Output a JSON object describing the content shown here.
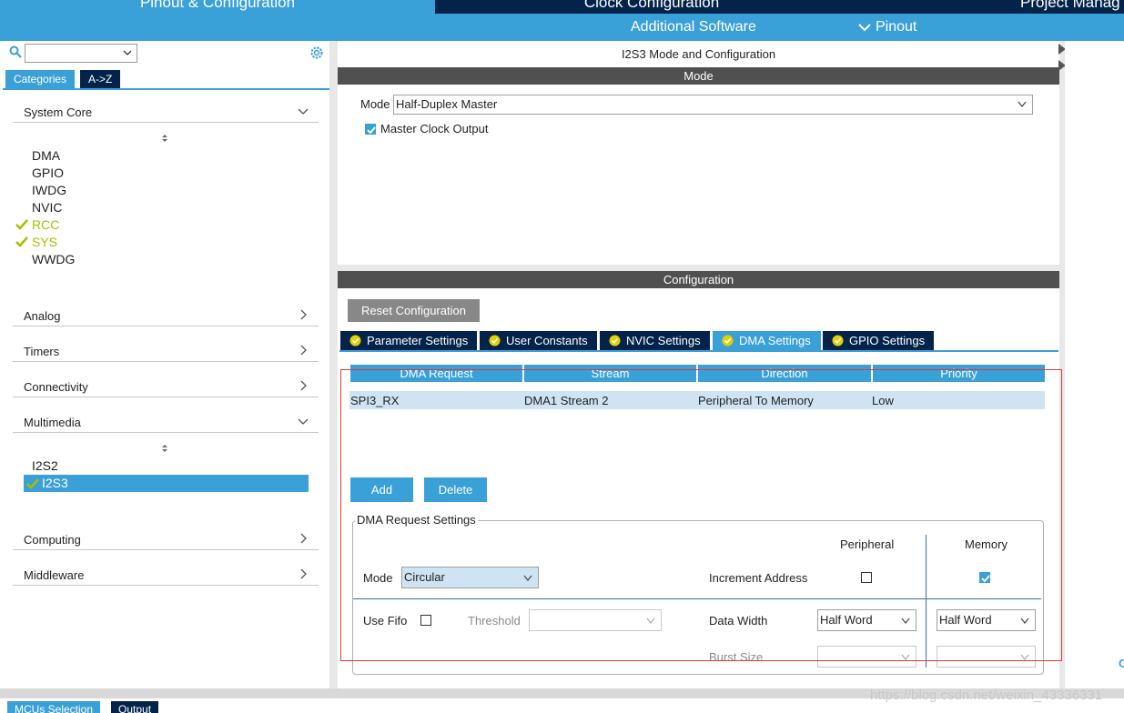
{
  "top_tabs": [
    {
      "label": "Pinout & Configuration"
    },
    {
      "label": "Clock Configuration"
    },
    {
      "label": "Project Manag"
    }
  ],
  "sub_nav": {
    "additional_software": "Additional Software",
    "pinout": "Pinout"
  },
  "left": {
    "category_tabs": [
      "Categories",
      "A->Z"
    ],
    "categories": [
      {
        "label": "System Core",
        "state": "expanded"
      },
      {
        "label": "Analog",
        "state": "collapsed"
      },
      {
        "label": "Timers",
        "state": "collapsed"
      },
      {
        "label": "Connectivity",
        "state": "collapsed"
      },
      {
        "label": "Multimedia",
        "state": "expanded"
      },
      {
        "label": "Computing",
        "state": "collapsed"
      },
      {
        "label": "Middleware",
        "state": "collapsed"
      }
    ],
    "system_core_items": [
      "DMA",
      "GPIO",
      "IWDG",
      "NVIC",
      "RCC",
      "SYS",
      "WWDG"
    ],
    "multimedia_items": [
      "I2S2",
      "I2S3"
    ]
  },
  "main": {
    "title": "I2S3 Mode and Configuration",
    "mode_bar": "Mode",
    "mode_label": "Mode",
    "mode_value": "Half-Duplex Master",
    "master_clock_output": "Master Clock Output",
    "config_bar": "Configuration",
    "reset_button": "Reset Configuration",
    "config_tabs": [
      "Parameter Settings",
      "User Constants",
      "NVIC Settings",
      "DMA Settings",
      "GPIO Settings"
    ],
    "dma_table": {
      "headers": [
        "DMA Request",
        "Stream",
        "Direction",
        "Priority"
      ],
      "rows": [
        [
          "SPI3_RX",
          "DMA1 Stream 2",
          "Peripheral To Memory",
          "Low"
        ]
      ]
    },
    "add_button": "Add",
    "delete_button": "Delete",
    "request_settings": {
      "title": "DMA Request Settings",
      "peripheral": "Peripheral",
      "memory": "Memory",
      "mode_label": "Mode",
      "mode_value": "Circular",
      "increment_address": "Increment Address",
      "use_fifo": "Use Fifo",
      "threshold": "Threshold",
      "data_width": "Data Width",
      "peripheral_width": "Half Word",
      "memory_width": "Half Word",
      "burst_size": "Burst Size"
    }
  },
  "bottom": {
    "tabs": [
      "MCUs Selection",
      "Output"
    ],
    "watermark": "https://blog.csdn.net/weixin_43336331"
  },
  "colors": {
    "navy": "#03234b",
    "accent_blue": "#3aa0d8",
    "check_green": "#a6bf00",
    "highlight_red": "#e03a3a"
  }
}
